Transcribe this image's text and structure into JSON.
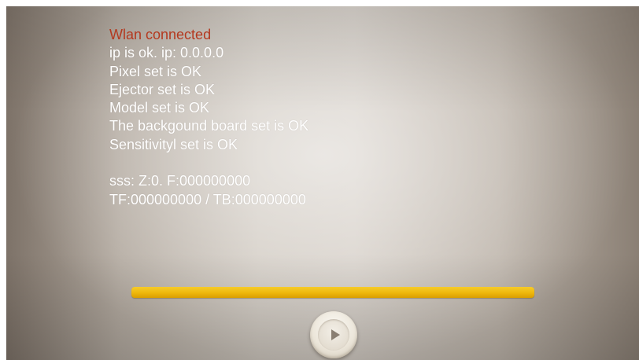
{
  "log": {
    "status": "Wlan connected",
    "lines": [
      "ip is ok. ip: 0.0.0.0",
      "Pixel set is OK",
      "Ejector set is OK",
      "Model set is OK",
      "The backgound board set is OK",
      "Sensitivityl set is OK"
    ],
    "counters": [
      "sss: Z:0. F:000000000",
      "TF:000000000 / TB:000000000"
    ]
  },
  "progress": {
    "percent": 100,
    "color": "#eeb70c"
  },
  "play_button": {
    "icon": "play-icon"
  },
  "colors": {
    "status_text": "#b4391f",
    "log_text": "#ffffff"
  }
}
